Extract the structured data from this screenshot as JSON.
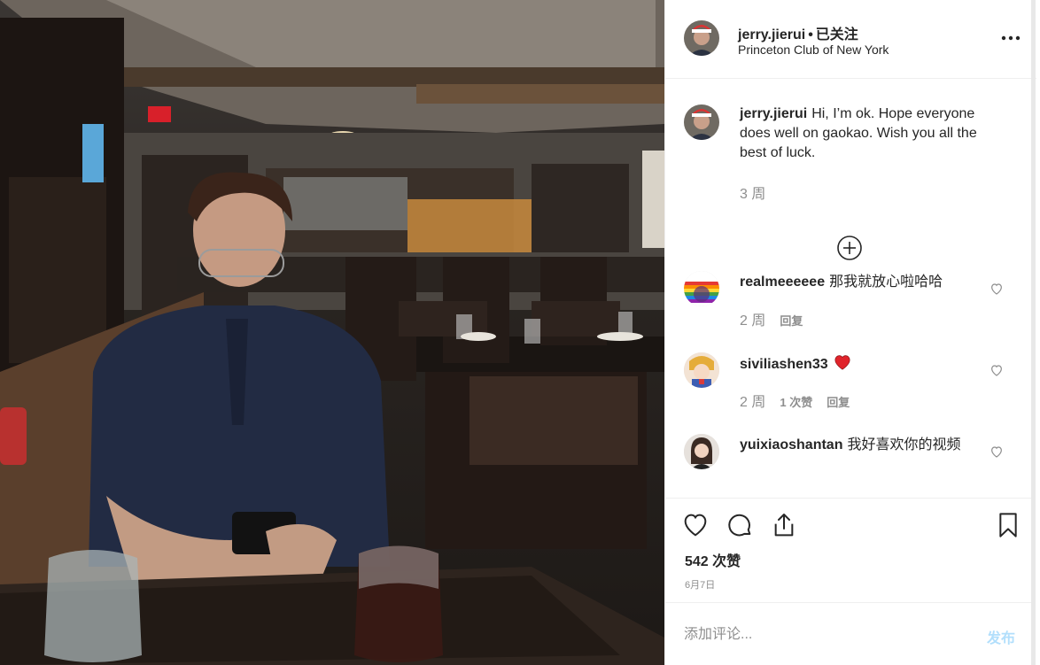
{
  "post": {
    "photo_icon": "restaurant-photo",
    "header": {
      "username": "jerry.jierui",
      "separator": "•",
      "follow_status": "已关注",
      "location": "Princeton Club of New York",
      "more_icon": "more-horizontal-icon"
    },
    "caption": {
      "username": "jerry.jierui",
      "text": "Hi, I’m ok. Hope everyone does well on gaokao. Wish you all the best of luck.",
      "time": "3 周"
    },
    "load_more_icon": "plus-circle-icon",
    "comments": [
      {
        "username": "realmeeeeee",
        "text": "那我就放心啦哈哈",
        "time": "2 周",
        "likes": "",
        "reply": "回复"
      },
      {
        "username": "siviliashen33",
        "text": "",
        "emoji": "red-heart",
        "time": "2 周",
        "likes": "1 次赞",
        "reply": "回复"
      },
      {
        "username": "yuixiaoshantan",
        "text": "我好喜欢你的视频",
        "time": "",
        "likes": "",
        "reply": ""
      }
    ],
    "actions": {
      "like_icon": "heart-icon",
      "comment_icon": "comment-icon",
      "share_icon": "share-icon",
      "save_icon": "bookmark-icon"
    },
    "likes_count": "542 次赞",
    "date": "6月7日",
    "comment_box": {
      "placeholder": "添加评论...",
      "post_label": "发布"
    },
    "colors": {
      "text": "#262626",
      "secondary": "#8e8e8e",
      "post_disabled": "#b2dffc",
      "heart": "#ed4956",
      "border": "#efefef"
    }
  }
}
